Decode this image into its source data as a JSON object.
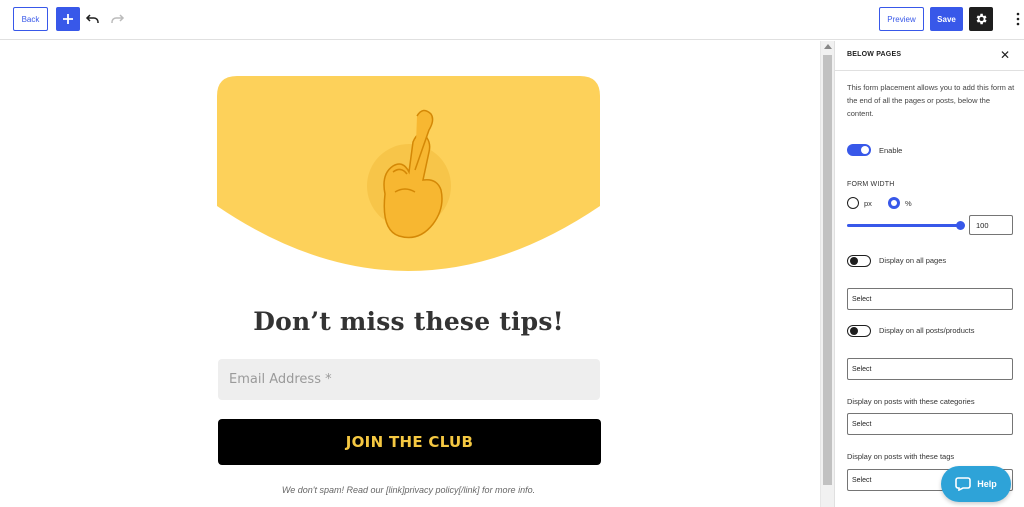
{
  "toolbar": {
    "back_label": "Back",
    "add_icon": "plus-icon",
    "undo_icon": "undo-icon",
    "redo_icon": "redo-icon",
    "preview_label": "Preview",
    "save_label": "Save",
    "settings_icon": "gear-icon",
    "more_icon": "more-vertical-icon",
    "accent_color": "#3858e9"
  },
  "canvas": {
    "hero_color": "#fdd15a",
    "hero_icon": "crossed-fingers-emoji",
    "headline": "Don’t miss these tips!",
    "email_placeholder": "Email Address *",
    "join_label": "JOIN THE CLUB",
    "join_text_color": "#f5c842",
    "disclaimer": "We don't spam! Read our [link]privacy policy[/link] for more info."
  },
  "panel": {
    "title": "BELOW PAGES",
    "close_icon": "close-icon",
    "description": "This form placement allows you to add this form at the end of all the pages or posts, below the content.",
    "enable_label": "Enable",
    "enable_on": true,
    "form_width_label": "FORM WIDTH",
    "unit_px": "px",
    "unit_pct": "%",
    "selected_unit": "%",
    "width_value": "100",
    "display_all_pages_label": "Display on all pages",
    "display_all_pages_on": false,
    "pages_select": "Select",
    "display_all_posts_label": "Display on all posts/products",
    "display_all_posts_on": false,
    "posts_select": "Select",
    "categories_label": "Display on posts with these categories",
    "categories_select": "Select",
    "tags_label": "Display on posts with these tags",
    "tags_select": "Select"
  },
  "help": {
    "label": "Help",
    "icon": "chat-bubble-icon",
    "color": "#2ea3d8"
  }
}
